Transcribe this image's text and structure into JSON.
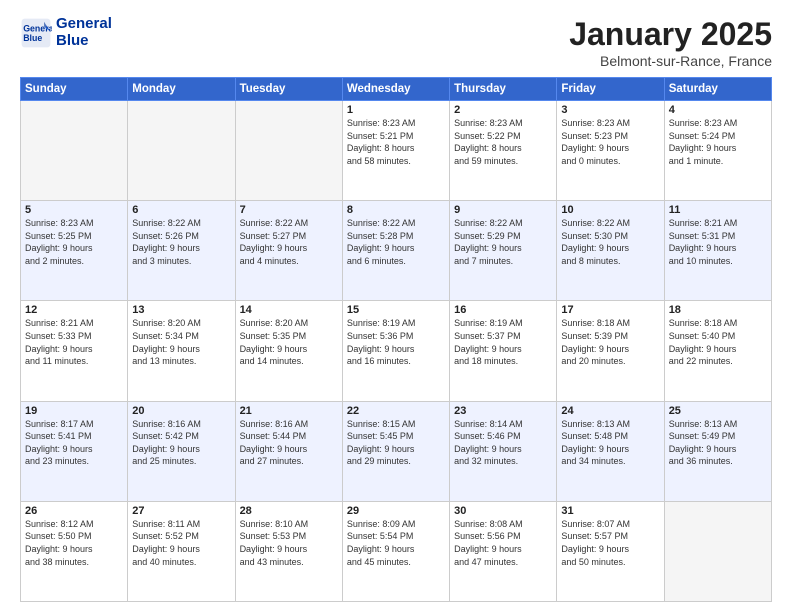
{
  "header": {
    "logo_line1": "General",
    "logo_line2": "Blue",
    "month": "January 2025",
    "location": "Belmont-sur-Rance, France"
  },
  "weekdays": [
    "Sunday",
    "Monday",
    "Tuesday",
    "Wednesday",
    "Thursday",
    "Friday",
    "Saturday"
  ],
  "weeks": [
    [
      {
        "day": "",
        "info": ""
      },
      {
        "day": "",
        "info": ""
      },
      {
        "day": "",
        "info": ""
      },
      {
        "day": "1",
        "info": "Sunrise: 8:23 AM\nSunset: 5:21 PM\nDaylight: 8 hours\nand 58 minutes."
      },
      {
        "day": "2",
        "info": "Sunrise: 8:23 AM\nSunset: 5:22 PM\nDaylight: 8 hours\nand 59 minutes."
      },
      {
        "day": "3",
        "info": "Sunrise: 8:23 AM\nSunset: 5:23 PM\nDaylight: 9 hours\nand 0 minutes."
      },
      {
        "day": "4",
        "info": "Sunrise: 8:23 AM\nSunset: 5:24 PM\nDaylight: 9 hours\nand 1 minute."
      }
    ],
    [
      {
        "day": "5",
        "info": "Sunrise: 8:23 AM\nSunset: 5:25 PM\nDaylight: 9 hours\nand 2 minutes."
      },
      {
        "day": "6",
        "info": "Sunrise: 8:22 AM\nSunset: 5:26 PM\nDaylight: 9 hours\nand 3 minutes."
      },
      {
        "day": "7",
        "info": "Sunrise: 8:22 AM\nSunset: 5:27 PM\nDaylight: 9 hours\nand 4 minutes."
      },
      {
        "day": "8",
        "info": "Sunrise: 8:22 AM\nSunset: 5:28 PM\nDaylight: 9 hours\nand 6 minutes."
      },
      {
        "day": "9",
        "info": "Sunrise: 8:22 AM\nSunset: 5:29 PM\nDaylight: 9 hours\nand 7 minutes."
      },
      {
        "day": "10",
        "info": "Sunrise: 8:22 AM\nSunset: 5:30 PM\nDaylight: 9 hours\nand 8 minutes."
      },
      {
        "day": "11",
        "info": "Sunrise: 8:21 AM\nSunset: 5:31 PM\nDaylight: 9 hours\nand 10 minutes."
      }
    ],
    [
      {
        "day": "12",
        "info": "Sunrise: 8:21 AM\nSunset: 5:33 PM\nDaylight: 9 hours\nand 11 minutes."
      },
      {
        "day": "13",
        "info": "Sunrise: 8:20 AM\nSunset: 5:34 PM\nDaylight: 9 hours\nand 13 minutes."
      },
      {
        "day": "14",
        "info": "Sunrise: 8:20 AM\nSunset: 5:35 PM\nDaylight: 9 hours\nand 14 minutes."
      },
      {
        "day": "15",
        "info": "Sunrise: 8:19 AM\nSunset: 5:36 PM\nDaylight: 9 hours\nand 16 minutes."
      },
      {
        "day": "16",
        "info": "Sunrise: 8:19 AM\nSunset: 5:37 PM\nDaylight: 9 hours\nand 18 minutes."
      },
      {
        "day": "17",
        "info": "Sunrise: 8:18 AM\nSunset: 5:39 PM\nDaylight: 9 hours\nand 20 minutes."
      },
      {
        "day": "18",
        "info": "Sunrise: 8:18 AM\nSunset: 5:40 PM\nDaylight: 9 hours\nand 22 minutes."
      }
    ],
    [
      {
        "day": "19",
        "info": "Sunrise: 8:17 AM\nSunset: 5:41 PM\nDaylight: 9 hours\nand 23 minutes."
      },
      {
        "day": "20",
        "info": "Sunrise: 8:16 AM\nSunset: 5:42 PM\nDaylight: 9 hours\nand 25 minutes."
      },
      {
        "day": "21",
        "info": "Sunrise: 8:16 AM\nSunset: 5:44 PM\nDaylight: 9 hours\nand 27 minutes."
      },
      {
        "day": "22",
        "info": "Sunrise: 8:15 AM\nSunset: 5:45 PM\nDaylight: 9 hours\nand 29 minutes."
      },
      {
        "day": "23",
        "info": "Sunrise: 8:14 AM\nSunset: 5:46 PM\nDaylight: 9 hours\nand 32 minutes."
      },
      {
        "day": "24",
        "info": "Sunrise: 8:13 AM\nSunset: 5:48 PM\nDaylight: 9 hours\nand 34 minutes."
      },
      {
        "day": "25",
        "info": "Sunrise: 8:13 AM\nSunset: 5:49 PM\nDaylight: 9 hours\nand 36 minutes."
      }
    ],
    [
      {
        "day": "26",
        "info": "Sunrise: 8:12 AM\nSunset: 5:50 PM\nDaylight: 9 hours\nand 38 minutes."
      },
      {
        "day": "27",
        "info": "Sunrise: 8:11 AM\nSunset: 5:52 PM\nDaylight: 9 hours\nand 40 minutes."
      },
      {
        "day": "28",
        "info": "Sunrise: 8:10 AM\nSunset: 5:53 PM\nDaylight: 9 hours\nand 43 minutes."
      },
      {
        "day": "29",
        "info": "Sunrise: 8:09 AM\nSunset: 5:54 PM\nDaylight: 9 hours\nand 45 minutes."
      },
      {
        "day": "30",
        "info": "Sunrise: 8:08 AM\nSunset: 5:56 PM\nDaylight: 9 hours\nand 47 minutes."
      },
      {
        "day": "31",
        "info": "Sunrise: 8:07 AM\nSunset: 5:57 PM\nDaylight: 9 hours\nand 50 minutes."
      },
      {
        "day": "",
        "info": ""
      }
    ]
  ]
}
